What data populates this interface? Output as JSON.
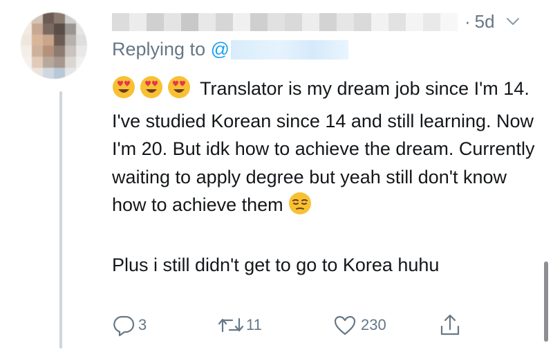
{
  "tweet": {
    "timestamp": "5d",
    "replying_prefix": "Replying to",
    "at_sign": "@",
    "paragraphs": [
      "Translator is my dream job since I'm 14. I've studied Korean since 14 and still learning. Now I'm 20. But idk how to achieve the dream. Currently waiting to apply degree but yeah still don't know how to achieve them",
      "Plus i still didn't get to go to Korea huhu"
    ]
  },
  "actions": {
    "reply_count": "3",
    "retweet_count": "11",
    "like_count": "230"
  },
  "icons": [
    "heart-eyes-emoji",
    "pensive-emoji",
    "chevron-down-icon",
    "reply-icon",
    "retweet-icon",
    "like-icon",
    "share-icon"
  ],
  "colors": {
    "text": "#14171a",
    "secondary": "#657786",
    "link": "#1da1f2",
    "thread_line": "#ccd6dd"
  }
}
